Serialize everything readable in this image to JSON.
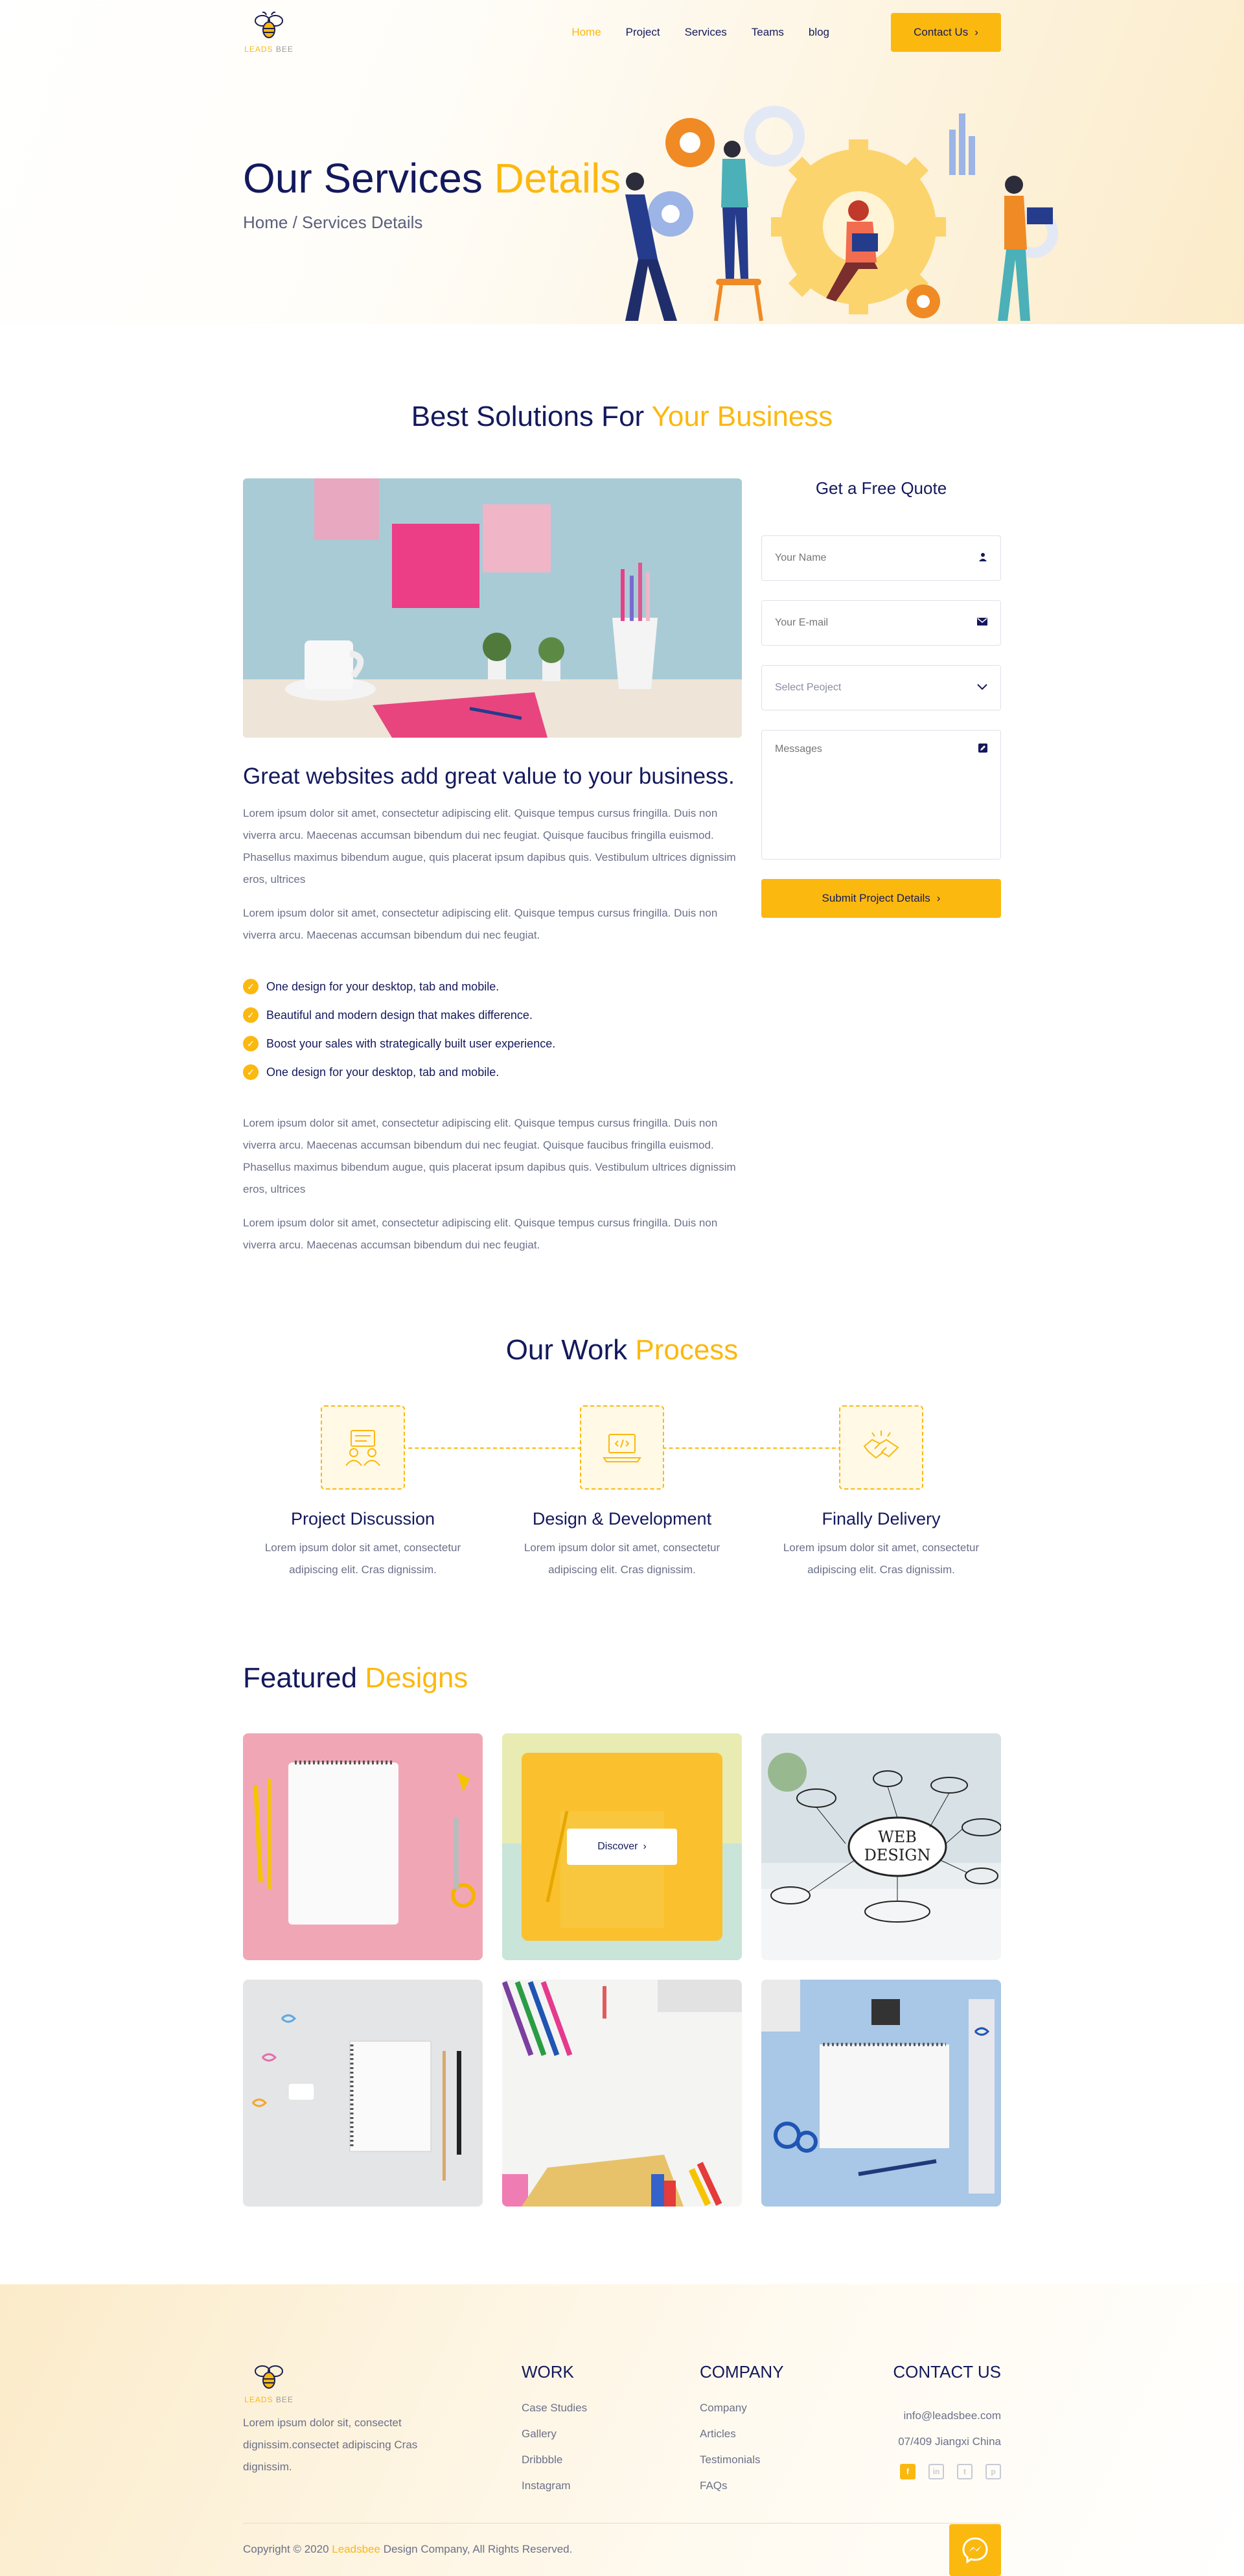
{
  "brand": {
    "logo_main": "LEADS",
    "logo_sub": "BEE"
  },
  "nav": {
    "items": [
      "Home",
      "Project",
      "Services",
      "Teams",
      "blog"
    ],
    "active": "Home",
    "contact_label": "Contact Us"
  },
  "hero": {
    "title_main": "Our Services",
    "title_accent": "Details",
    "breadcrumb": "Home / Services Details"
  },
  "solutions": {
    "title_main": "Best Solutions For",
    "title_accent": "Your Business",
    "heading": "Great websites add great value to your business.",
    "para1": "Lorem ipsum dolor sit amet, consectetur adipiscing elit. Quisque tempus cursus fringilla. Duis non viverra arcu. Maecenas accumsan bibendum dui nec feugiat. Quisque faucibus fringilla euismod. Phasellus maximus bibendum augue, quis placerat ipsum dapibus quis. Vestibulum ultrices dignissim eros, ultrices",
    "para2": "Lorem ipsum dolor sit amet, consectetur adipiscing elit. Quisque tempus cursus fringilla. Duis non viverra arcu. Maecenas accumsan bibendum dui nec feugiat.",
    "checks": [
      "One design for your desktop, tab and mobile.",
      "Beautiful and modern design that makes difference.",
      "Boost your sales with strategically built user experience.",
      "One design for your desktop, tab and mobile."
    ],
    "para3": "Lorem ipsum dolor sit amet, consectetur adipiscing elit. Quisque tempus cursus fringilla. Duis non viverra arcu. Maecenas accumsan bibendum dui nec feugiat. Quisque faucibus fringilla euismod. Phasellus maximus bibendum augue, quis placerat ipsum dapibus quis. Vestibulum ultrices dignissim eros, ultrices",
    "para4": "Lorem ipsum dolor sit amet, consectetur adipiscing elit. Quisque tempus cursus fringilla. Duis non viverra arcu. Maecenas accumsan bibendum dui nec feugiat."
  },
  "quote": {
    "title": "Get a Free Quote",
    "name_placeholder": "Your Name",
    "email_placeholder": "Your E-mail",
    "project_select": "Select Peoject",
    "message_placeholder": "Messages",
    "submit_label": "Submit Project Details"
  },
  "process": {
    "title_main": "Our Work",
    "title_accent": "Process",
    "steps": [
      {
        "title": "Project Discussion",
        "desc": "Lorem ipsum dolor sit amet, consectetur adipiscing elit. Cras dignissim."
      },
      {
        "title": "Design & Development",
        "desc": "Lorem ipsum dolor sit amet, consectetur adipiscing elit. Cras dignissim."
      },
      {
        "title": "Finally Delivery",
        "desc": "Lorem ipsum dolor sit amet, consectetur adipiscing elit. Cras dignissim."
      }
    ]
  },
  "featured": {
    "title_main": "Featured",
    "title_accent": "Designs",
    "discover_label": "Discover"
  },
  "footer": {
    "about": "Lorem ipsum dolor sit, consectet dignissim.consectet adipiscing Cras dignissim.",
    "work": {
      "title": "WORK",
      "links": [
        "Case Studies",
        "Gallery",
        "Dribbble",
        "Instagram"
      ]
    },
    "company": {
      "title": "COMPANY",
      "links": [
        "Company",
        "Articles",
        "Testimonials",
        "FAQs"
      ]
    },
    "contact": {
      "title": "CONTACT US",
      "email": "info@leadsbee.com",
      "address": "07/409 Jiangxi China"
    },
    "copyright_pre": "Copyright © 2020",
    "copyright_brand": "Leadsbee",
    "copyright_post": "Design Company, All Rights Reserved."
  },
  "colors": {
    "accent": "#fbb80f",
    "navy": "#14195c",
    "muted": "#6b7089"
  },
  "icons": [
    "chevron-right-icon",
    "user-icon",
    "mail-icon",
    "chevron-down-icon",
    "edit-icon",
    "check-icon",
    "facebook-icon",
    "linkedin-icon",
    "twitter-icon",
    "pinterest-icon",
    "messenger-icon"
  ]
}
